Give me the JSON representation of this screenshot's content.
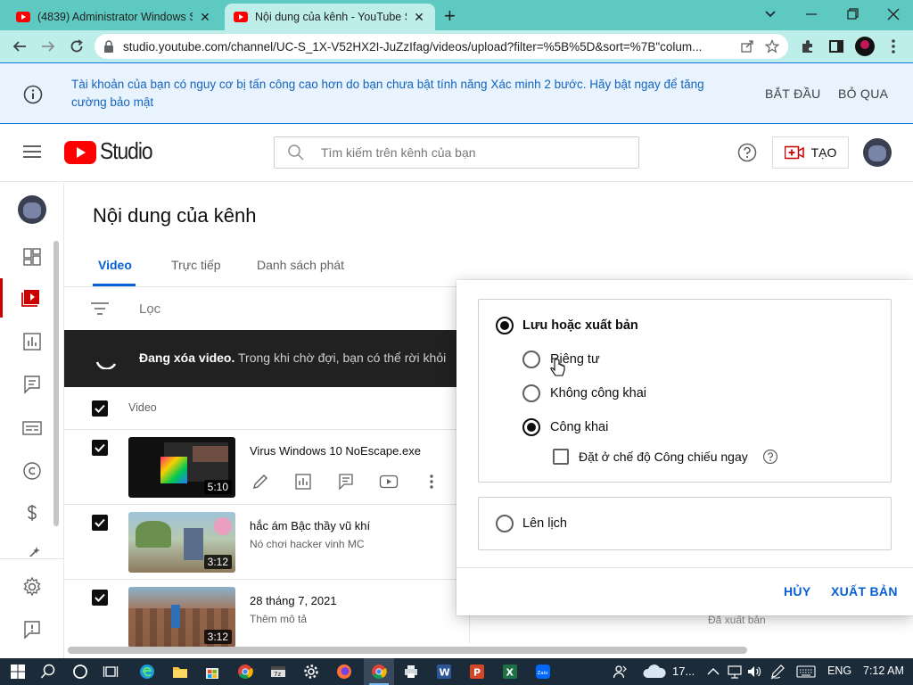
{
  "browser": {
    "tabs": [
      {
        "title": "(4839) Administrator Windows Se",
        "close": "✕"
      },
      {
        "title": "Nội dung của kênh - YouTube Stu",
        "close": "✕"
      }
    ],
    "new_tab": "+",
    "url": "studio.youtube.com/channel/UC-S_1X-V52HX2I-JuZzIfag/videos/upload?filter=%5B%5D&sort=%7B\"colum..."
  },
  "banner": {
    "message": "Tài khoản của bạn có nguy cơ bị tấn công cao hơn do bạn chưa bật tính năng Xác minh 2 bước. Hãy bật ngay để tăng cường bảo mật",
    "start": "BẮT ĐẦU",
    "skip": "BỎ QUA"
  },
  "header": {
    "logo": "Studio",
    "search_placeholder": "Tìm kiếm trên kênh của bạn",
    "create": "TẠO"
  },
  "page": {
    "title": "Nội dung của kênh",
    "tabs": [
      "Video",
      "Trực tiếp",
      "Danh sách phát"
    ],
    "filter": "Lọc",
    "deleting_bold": "Đang xóa video.",
    "deleting_rest": " Trong khi chờ đợi, bạn có thể rời khỏi",
    "column_video": "Video",
    "videos": [
      {
        "title": "Virus Windows 10 NoEscape.exe",
        "subtitle": "",
        "duration": "5:10"
      },
      {
        "title": "hắc ám Bậc thầy vũ khí",
        "subtitle": "Nó chơi hacker vinh MC",
        "duration": "3:12"
      },
      {
        "title": "28 tháng 7, 2021",
        "subtitle": "Thêm mô tả",
        "duration": "3:12"
      }
    ],
    "published_status": "Đã xuất bản"
  },
  "publish_panel": {
    "save_or_publish": "Lưu hoặc xuất bản",
    "private": "Riêng tư",
    "unlisted": "Không công khai",
    "public": "Công khai",
    "premiere": "Đặt ở chế độ Công chiếu ngay",
    "schedule": "Lên lịch",
    "cancel": "HỦY",
    "publish": "XUẤT BẢN"
  },
  "taskbar": {
    "weather": "17...",
    "language": "ENG",
    "time": "7:12 AM"
  },
  "colors": {
    "tab_strip": "#5ec9c1",
    "toolbar": "#bdeee9",
    "banner_bg": "#e8f3fd",
    "link_blue": "#065fd4",
    "yt_red": "#ff0000"
  }
}
